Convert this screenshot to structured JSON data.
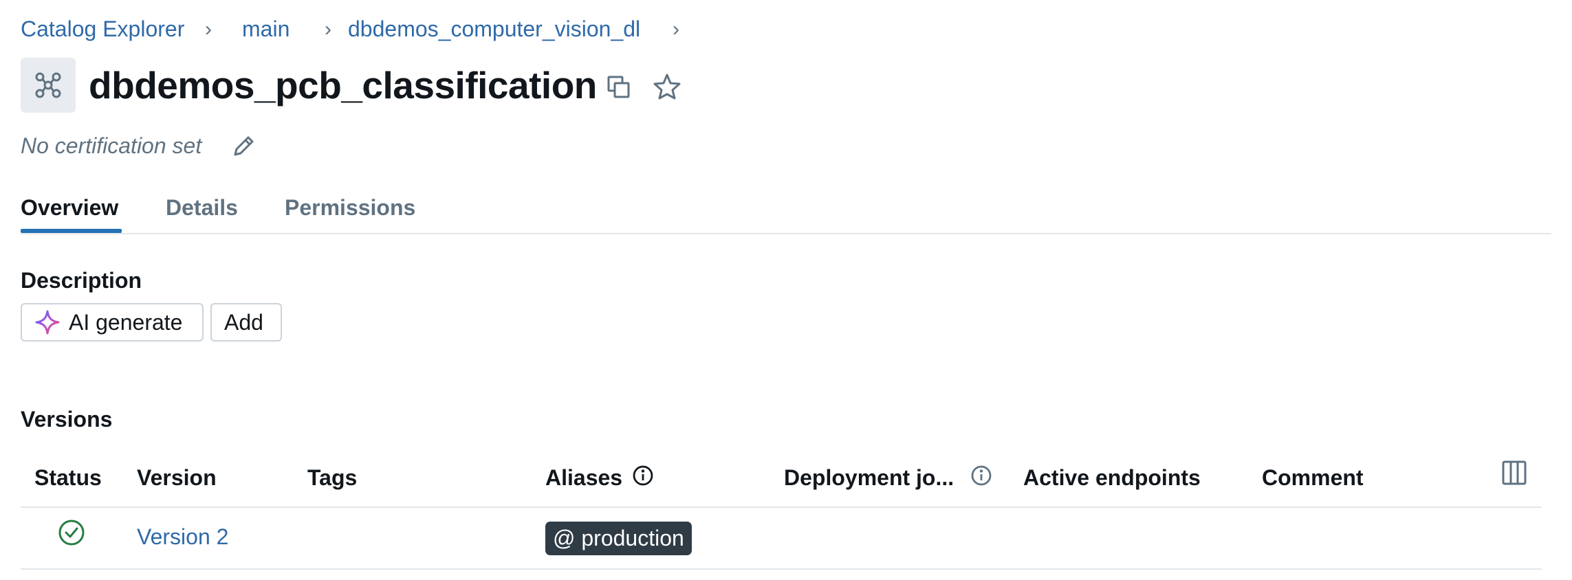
{
  "breadcrumb": {
    "items": [
      "Catalog Explorer",
      "main",
      "dbdemos_computer_vision_dl"
    ],
    "separator": "›"
  },
  "header": {
    "title": "dbdemos_pcb_classification",
    "icon": "model-icon",
    "actions": [
      "copy-icon",
      "star-icon"
    ],
    "certification": "No certification set"
  },
  "tabs": [
    {
      "label": "Overview",
      "active": true
    },
    {
      "label": "Details",
      "active": false
    },
    {
      "label": "Permissions",
      "active": false
    }
  ],
  "description": {
    "title": "Description",
    "ai_generate_label": "AI generate",
    "add_label": "Add"
  },
  "versions": {
    "title": "Versions",
    "columns": [
      "Status",
      "Version",
      "Tags",
      "Aliases",
      "Deployment jo...",
      "Active endpoints",
      "Comment"
    ],
    "rows": [
      {
        "status": "ready",
        "version": "Version 2",
        "tags": "",
        "alias": "@ production",
        "deployment_job": "",
        "active_endpoints": "",
        "comment": ""
      }
    ]
  },
  "colors": {
    "link": "#2f6aa8",
    "tab_accent": "#2272b4",
    "status_ok": "#277c43",
    "badge_bg": "#2f3b45"
  }
}
